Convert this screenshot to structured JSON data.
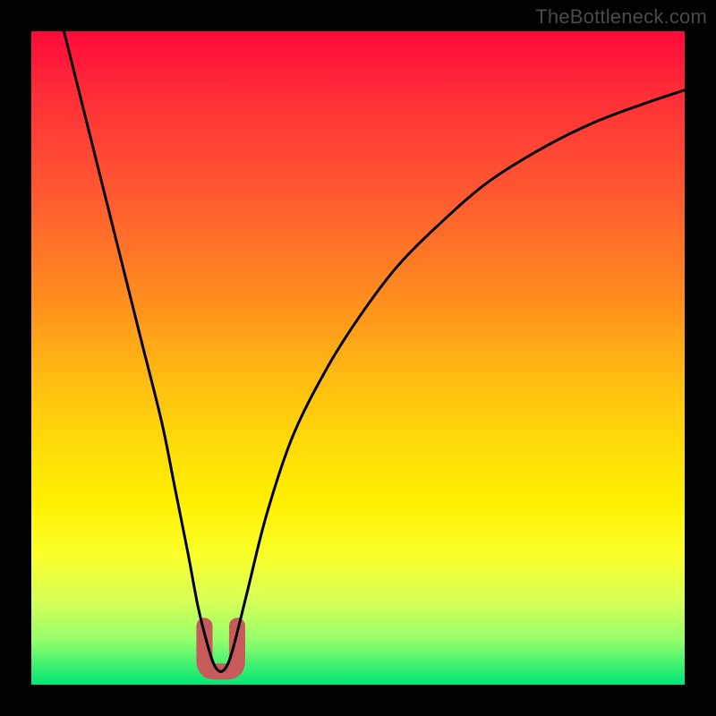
{
  "watermark": "TheBottleneck.com",
  "colors": {
    "page_bg": "#000000",
    "curve": "#000000",
    "highlight": "#c75a5a",
    "gradient_top": "#ff0a3a",
    "gradient_bottom": "#00e676"
  },
  "chart_data": {
    "type": "line",
    "title": "",
    "xlabel": "",
    "ylabel": "",
    "xlim": [
      0,
      100
    ],
    "ylim": [
      0,
      100
    ],
    "grid": false,
    "legend": false,
    "series": [
      {
        "name": "bottleneck-curve",
        "x": [
          5,
          8,
          11,
          14,
          17,
          20,
          22,
          24,
          25.5,
          27,
          28,
          29,
          30,
          31,
          33,
          36,
          40,
          45,
          50,
          56,
          63,
          70,
          78,
          86,
          94,
          100
        ],
        "y": [
          100,
          88,
          76,
          64,
          52,
          40,
          30,
          20,
          12,
          6,
          3,
          2,
          3,
          6,
          14,
          26,
          38,
          48,
          56,
          64,
          71,
          77,
          82,
          86,
          89,
          91
        ]
      }
    ],
    "highlight_region": {
      "description": "rounded U segment near curve minimum",
      "x_range": [
        26.5,
        31.5
      ],
      "y_range": [
        2,
        9
      ]
    },
    "annotations": []
  }
}
